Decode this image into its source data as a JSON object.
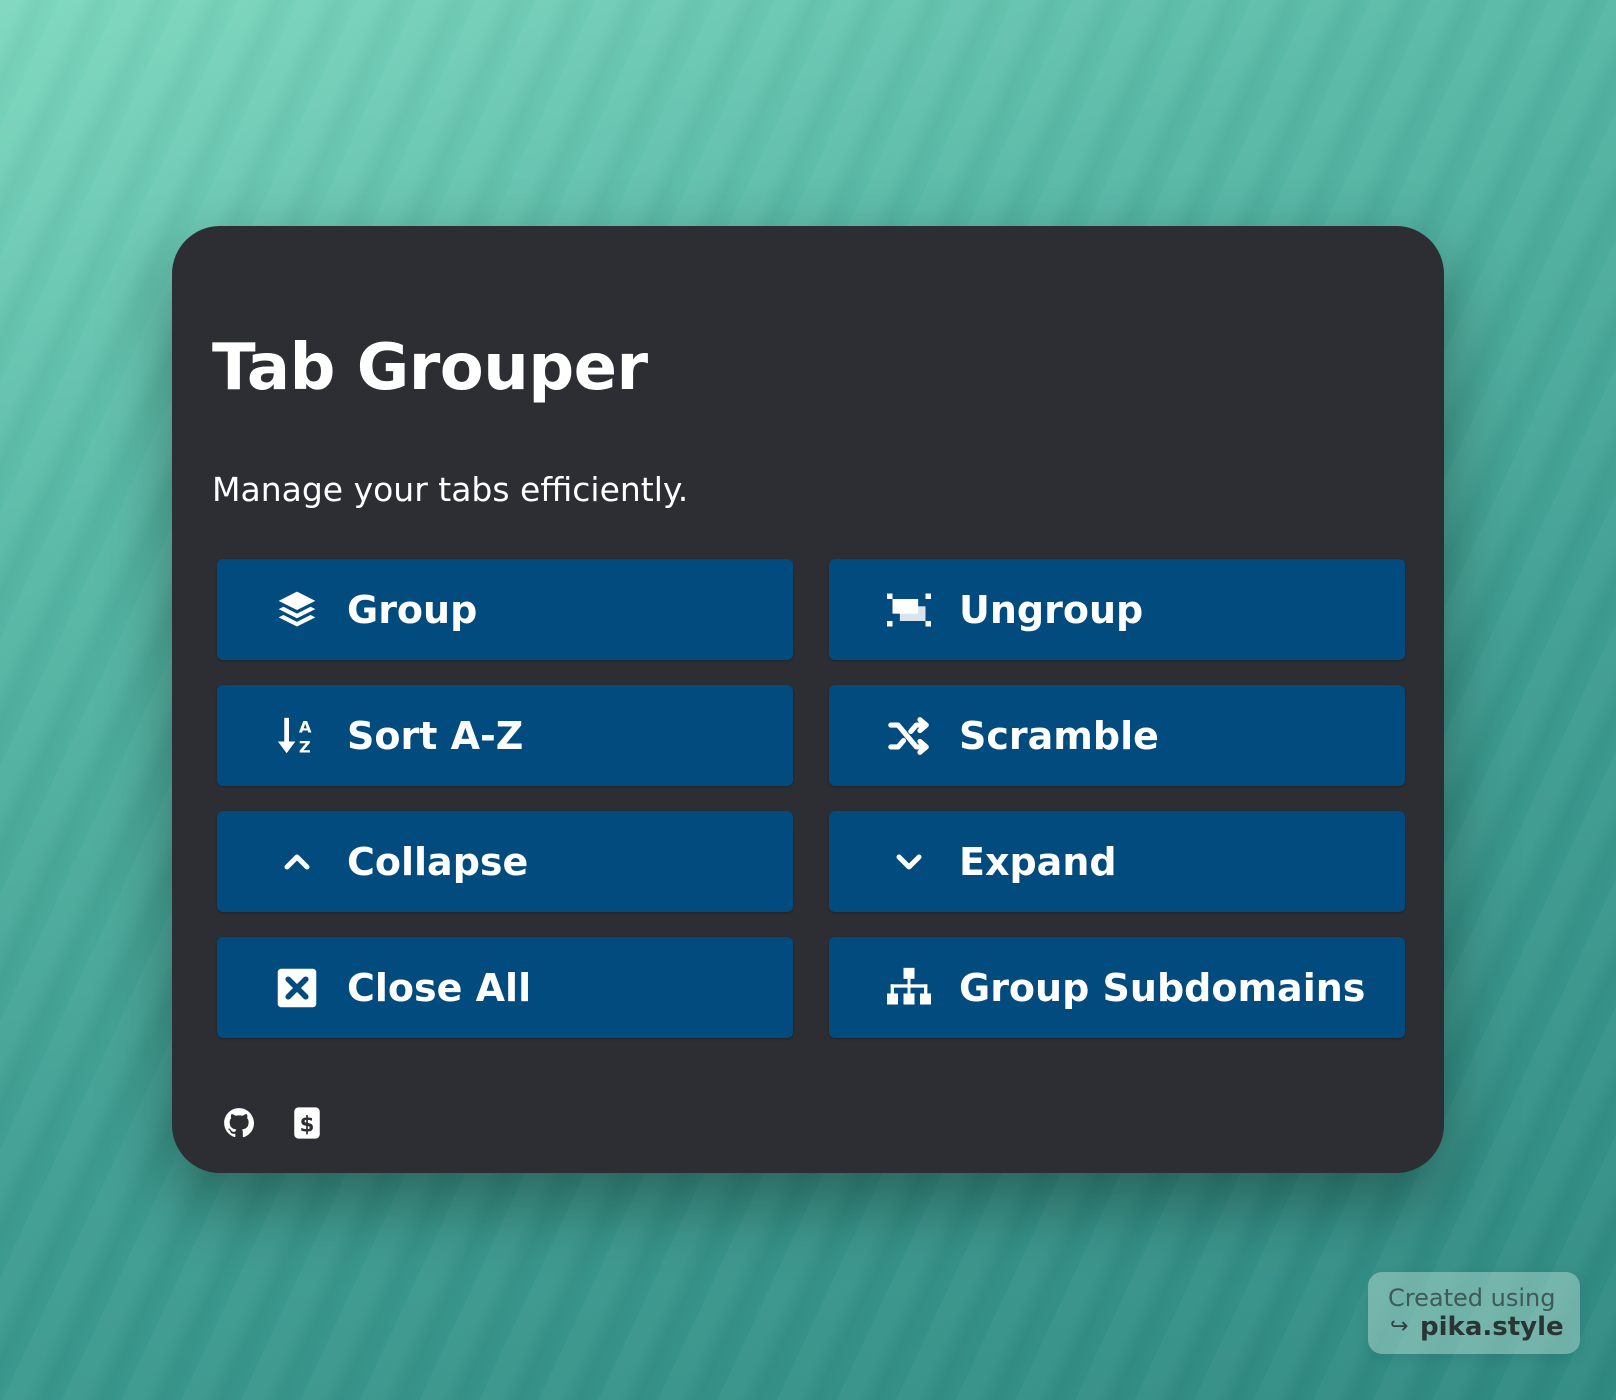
{
  "app": {
    "title": "Tab Grouper",
    "subtitle": "Manage your tabs efficiently."
  },
  "colors": {
    "card_bg": "#2c2e33",
    "button_bg": "#024b7e",
    "text": "#ffffff",
    "background_accent": "#5fbfa9"
  },
  "buttons": [
    {
      "label": "Group",
      "icon": "layers-icon"
    },
    {
      "label": "Ungroup",
      "icon": "ungroup-icon"
    },
    {
      "label": "Sort A-Z",
      "icon": "sort-alpha-down-icon"
    },
    {
      "label": "Scramble",
      "icon": "shuffle-icon"
    },
    {
      "label": "Collapse",
      "icon": "chevron-up-icon"
    },
    {
      "label": "Expand",
      "icon": "chevron-down-icon"
    },
    {
      "label": "Close All",
      "icon": "close-square-icon"
    },
    {
      "label": "Group Subdomains",
      "icon": "sitemap-icon"
    }
  ],
  "footer": {
    "links": [
      {
        "icon": "github-icon"
      },
      {
        "icon": "donate-dollar-icon"
      }
    ]
  },
  "watermark": {
    "line1": "Created using",
    "arrow": "↪",
    "line2": "pika.style"
  }
}
